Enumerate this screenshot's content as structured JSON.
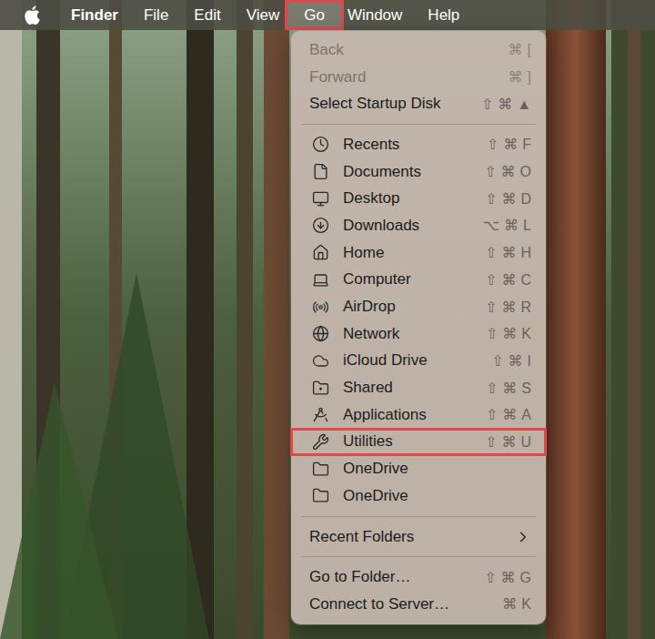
{
  "menubar": {
    "items": [
      {
        "label": "Finder",
        "bold": true,
        "highlighted": false
      },
      {
        "label": "File",
        "bold": false,
        "highlighted": false
      },
      {
        "label": "Edit",
        "bold": false,
        "highlighted": false
      },
      {
        "label": "View",
        "bold": false,
        "highlighted": false
      },
      {
        "label": "Go",
        "bold": false,
        "highlighted": true
      },
      {
        "label": "Window",
        "bold": false,
        "highlighted": false
      },
      {
        "label": "Help",
        "bold": false,
        "highlighted": false
      }
    ]
  },
  "menu": {
    "sections": [
      {
        "items": [
          {
            "label": "Back",
            "shortcut": "⌘[",
            "disabled": true,
            "highlighted": false,
            "hasIcon": false,
            "submenu": false
          },
          {
            "label": "Forward",
            "shortcut": "⌘]",
            "disabled": true,
            "highlighted": false,
            "hasIcon": false,
            "submenu": false
          },
          {
            "label": "Select Startup Disk",
            "shortcut": "⇧⌘▲",
            "disabled": false,
            "highlighted": false,
            "hasIcon": false,
            "submenu": false
          }
        ]
      },
      {
        "items": [
          {
            "label": "Recents",
            "shortcut": "⇧⌘F",
            "disabled": false,
            "highlighted": false,
            "hasIcon": true,
            "submenu": false
          },
          {
            "label": "Documents",
            "shortcut": "⇧⌘O",
            "disabled": false,
            "highlighted": false,
            "hasIcon": true,
            "submenu": false
          },
          {
            "label": "Desktop",
            "shortcut": "⇧⌘D",
            "disabled": false,
            "highlighted": false,
            "hasIcon": true,
            "submenu": false
          },
          {
            "label": "Downloads",
            "shortcut": "⌥⌘L",
            "disabled": false,
            "highlighted": false,
            "hasIcon": true,
            "submenu": false
          },
          {
            "label": "Home",
            "shortcut": "⇧⌘H",
            "disabled": false,
            "highlighted": false,
            "hasIcon": true,
            "submenu": false
          },
          {
            "label": "Computer",
            "shortcut": "⇧⌘C",
            "disabled": false,
            "highlighted": false,
            "hasIcon": true,
            "submenu": false
          },
          {
            "label": "AirDrop",
            "shortcut": "⇧⌘R",
            "disabled": false,
            "highlighted": false,
            "hasIcon": true,
            "submenu": false
          },
          {
            "label": "Network",
            "shortcut": "⇧⌘K",
            "disabled": false,
            "highlighted": false,
            "hasIcon": true,
            "submenu": false
          },
          {
            "label": "iCloud Drive",
            "shortcut": "⇧⌘I",
            "disabled": false,
            "highlighted": false,
            "hasIcon": true,
            "submenu": false
          },
          {
            "label": "Shared",
            "shortcut": "⇧⌘S",
            "disabled": false,
            "highlighted": false,
            "hasIcon": true,
            "submenu": false
          },
          {
            "label": "Applications",
            "shortcut": "⇧⌘A",
            "disabled": false,
            "highlighted": false,
            "hasIcon": true,
            "submenu": false
          },
          {
            "label": "Utilities",
            "shortcut": "⇧⌘U",
            "disabled": false,
            "highlighted": true,
            "hasIcon": true,
            "submenu": false
          },
          {
            "label": "OneDrive",
            "shortcut": "",
            "disabled": false,
            "highlighted": false,
            "hasIcon": true,
            "submenu": false
          },
          {
            "label": "OneDrive",
            "shortcut": "",
            "disabled": false,
            "highlighted": false,
            "hasIcon": true,
            "submenu": false
          }
        ]
      },
      {
        "items": [
          {
            "label": "Recent Folders",
            "shortcut": "",
            "disabled": false,
            "highlighted": false,
            "hasIcon": false,
            "submenu": true
          }
        ]
      },
      {
        "items": [
          {
            "label": "Go to Folder…",
            "shortcut": "⇧⌘G",
            "disabled": false,
            "highlighted": false,
            "hasIcon": false,
            "submenu": false
          },
          {
            "label": "Connect to Server…",
            "shortcut": "⌘K",
            "disabled": false,
            "highlighted": false,
            "hasIcon": false,
            "submenu": false
          }
        ]
      }
    ]
  }
}
